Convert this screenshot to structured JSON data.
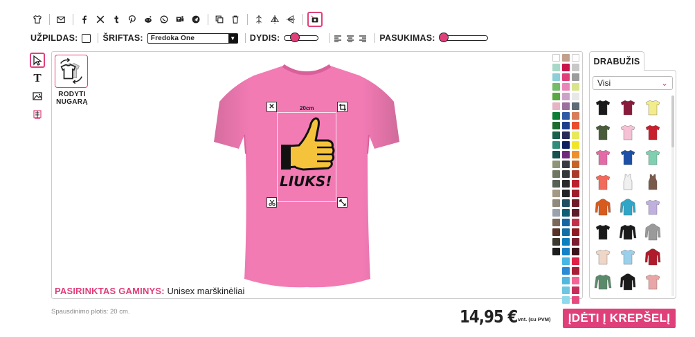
{
  "toolbar": {
    "icons": [
      "tshirt-icon",
      "mail-icon",
      "facebook-icon",
      "x-icon",
      "tumblr-icon",
      "pinterest-icon",
      "reddit-icon",
      "whatsapp-icon",
      "teams-icon",
      "telegram-icon",
      "copy-icon",
      "trash-icon",
      "align-center-icon",
      "flip-horizontal-icon",
      "flip-vertical-icon",
      "preview-icon"
    ]
  },
  "options": {
    "fill_label": "UŽPILDAS:",
    "font_label": "ŠRIFTAS:",
    "font_value": "Fredoka One",
    "size_label": "DYDIS:",
    "rotation_label": "PASUKIMAS:"
  },
  "show_back": {
    "label": "RODYTI NUGARĄ"
  },
  "design": {
    "print_width": "20cm",
    "text": "LIUKS!"
  },
  "product": {
    "label": "PASIRINKTAS GAMINYS:",
    "value": "Unisex marškinėliai",
    "color": "#f27bb4"
  },
  "panel": {
    "tab": "DRABUŽIS",
    "filter": "Visi"
  },
  "swatch_colors": [
    "#ffffff",
    "#c2a08d",
    "#ffffff",
    "#a8d8c8",
    "#c9154a",
    "#c8c8c8",
    "#8ccfd8",
    "#e0407a",
    "#9c9c9c",
    "#75bb6a",
    "#e886b8",
    "#d9e48c",
    "#5aa842",
    "#cca3c8",
    "#e8e8e8",
    "#e6b4c2",
    "#9b6f9e",
    "#5f6b75",
    "#0b7d36",
    "#2d59a5",
    "#d77d5a",
    "#1a6c2f",
    "#1d3e8c",
    "#ea4c2c",
    "#17604a",
    "#262b58",
    "#e6e95a",
    "#2f8c79",
    "#10205c",
    "#f1e52c",
    "#16504f",
    "#6f2a7b",
    "#ef8e2b",
    "#8e9477",
    "#383a41",
    "#c46228",
    "#6f7763",
    "#34383a",
    "#ab392a",
    "#566156",
    "#2a2a2a",
    "#bc1f2e",
    "#a39a86",
    "#222426",
    "#9d1d2b",
    "#8f8a7c",
    "#1e4f63",
    "#6e1a27",
    "#9aa3ad",
    "#105e73",
    "#5b1b2a",
    "#7a695b",
    "#1565a3",
    "#c2314a",
    "#573427",
    "#0f6fa6",
    "#8d1a22",
    "#3c3a2e",
    "#0a80c0",
    "#7a1d2f",
    "#1d1d1d",
    "#1681c7",
    "#3a1418",
    "",
    "#48b7e4",
    "#df2146",
    "",
    "#2b89d6",
    "#a71f34",
    "",
    "#52b8df",
    "#f26494",
    "",
    "#6fc6e0",
    "#c72d5b",
    "",
    "#8fd9ec",
    "#e64b7f"
  ],
  "garments": [
    {
      "icon": "tshirt-icon",
      "color": "#1a1a1a"
    },
    {
      "icon": "tshirt-icon",
      "color": "#8a1a3a"
    },
    {
      "icon": "tshirt-icon",
      "color": "#f3ec8a"
    },
    {
      "icon": "tshirt-icon",
      "color": "#4a5b3a"
    },
    {
      "icon": "tshirt-icon",
      "color": "#f6c1d4"
    },
    {
      "icon": "tshirt-icon",
      "color": "#c81e2e"
    },
    {
      "icon": "tshirt-icon",
      "color": "#e36aa6"
    },
    {
      "icon": "tshirt-icon",
      "color": "#1b4fa8"
    },
    {
      "icon": "tshirt-icon",
      "color": "#7fd0b0"
    },
    {
      "icon": "tshirt-icon",
      "color": "#f26a5a"
    },
    {
      "icon": "tanktop-icon",
      "color": "#f0f0f0"
    },
    {
      "icon": "tanktop-icon",
      "color": "#7a5a4a"
    },
    {
      "icon": "hoodie-icon",
      "color": "#d85a1c"
    },
    {
      "icon": "hoodie-icon",
      "color": "#2fa6c8"
    },
    {
      "icon": "tshirt-icon",
      "color": "#c0b0e0"
    },
    {
      "icon": "tshirt-icon",
      "color": "#1a1a1a"
    },
    {
      "icon": "longsleeve-icon",
      "color": "#1a1a1a"
    },
    {
      "icon": "hoodie-icon",
      "color": "#9a9a9a"
    },
    {
      "icon": "tshirt-icon",
      "color": "#efd6c6"
    },
    {
      "icon": "tshirt-icon",
      "color": "#9ad0ec"
    },
    {
      "icon": "hoodie-icon",
      "color": "#b01a2a"
    },
    {
      "icon": "longsleeve-icon",
      "color": "#5a8a6a"
    },
    {
      "icon": "hoodie-icon",
      "color": "#1a1a1a"
    },
    {
      "icon": "tshirt-icon",
      "color": "#e8a6a6"
    }
  ],
  "footer": {
    "print_width_note": "Spausdinimo plotis: 20 cm.",
    "price": "14,95 €",
    "unit": "vnt. (su PVM)",
    "cart_button": "ĮDĖTI Į KREPŠELĮ"
  }
}
